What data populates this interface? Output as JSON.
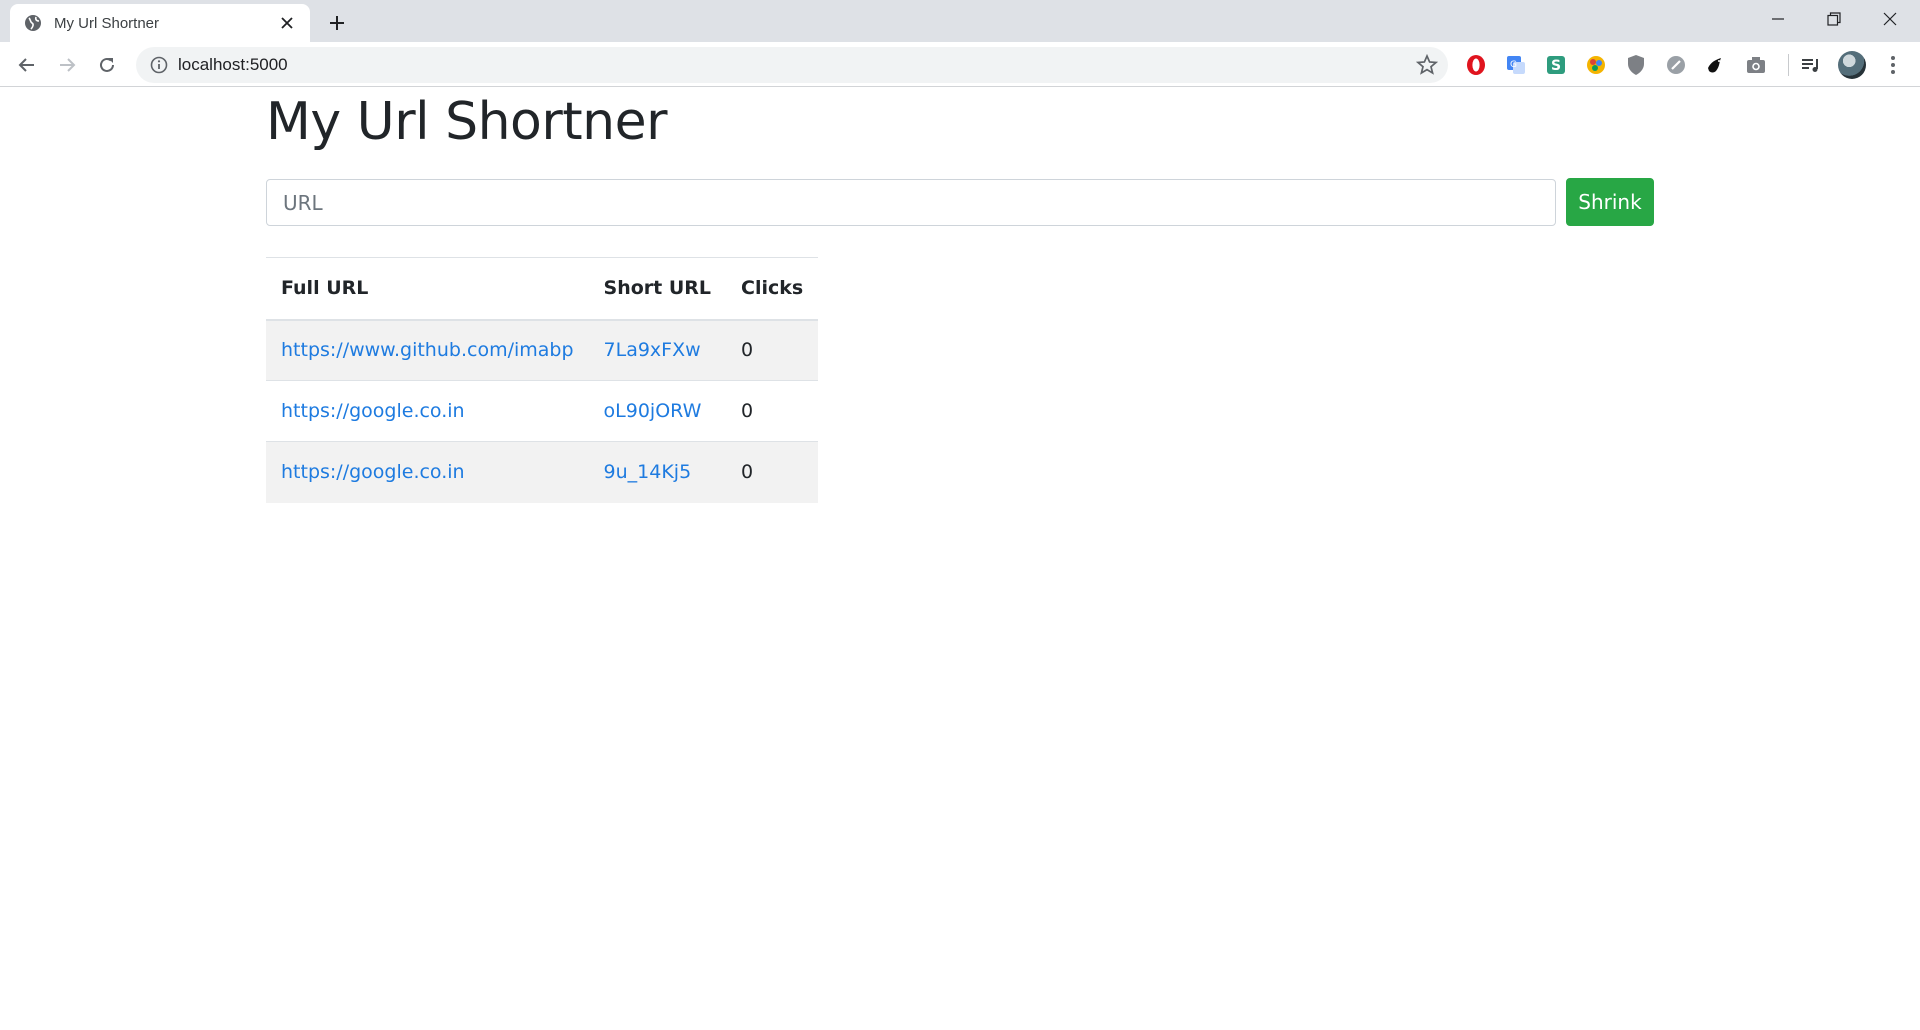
{
  "browser": {
    "tab_title": "My Url Shortner",
    "address": "localhost:5000",
    "extension_icons": [
      "opera-icon",
      "google-translate-icon",
      "s-extension-icon",
      "colorful-extension-icon",
      "shield-icon",
      "speed-icon",
      "bird-icon",
      "camera-icon"
    ],
    "colors": {
      "chrome_bg": "#dee1e6",
      "omnibox_bg": "#f1f3f4"
    }
  },
  "page": {
    "title": "My Url Shortner",
    "form": {
      "url_placeholder": "URL",
      "url_value": "",
      "submit_label": "Shrink",
      "submit_color": "#28a745"
    },
    "table": {
      "headers": {
        "full_url": "Full URL",
        "short_url": "Short URL",
        "clicks": "Clicks"
      },
      "rows": [
        {
          "full_url": "https://www.github.com/imabp",
          "short_url": "7La9xFXw",
          "clicks": "0"
        },
        {
          "full_url": "https://google.co.in",
          "short_url": "oL90jORW",
          "clicks": "0"
        },
        {
          "full_url": "https://google.co.in",
          "short_url": "9u_14Kj5",
          "clicks": "0"
        }
      ],
      "link_color": "#1e7be0"
    }
  }
}
